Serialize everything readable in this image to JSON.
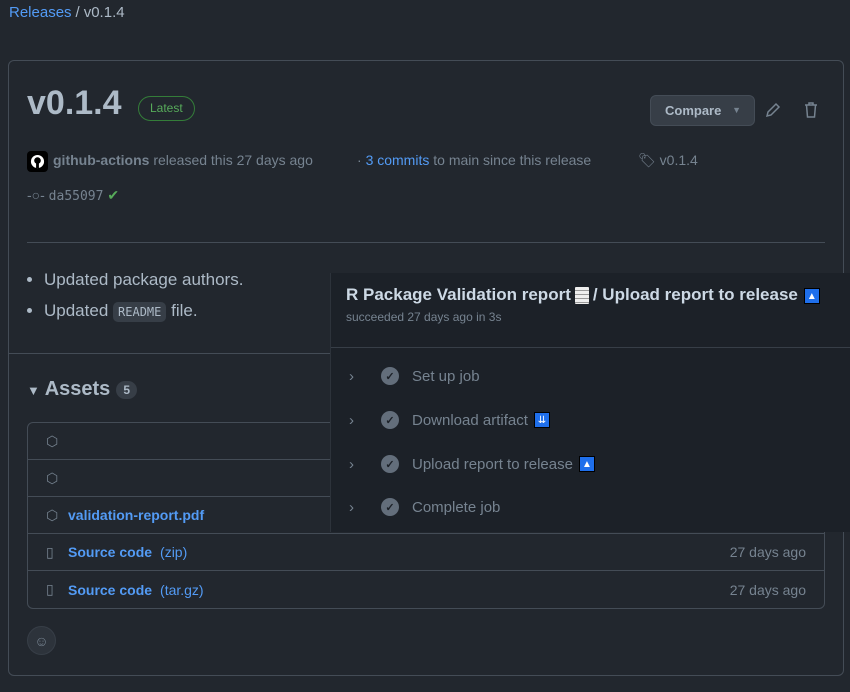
{
  "breadcrumb": {
    "releases": "Releases",
    "separator": "/",
    "current": "v0.1.4"
  },
  "release": {
    "title": "v0.1.4",
    "badge": "Latest",
    "compare": "Compare",
    "author": "github-actions",
    "released": "released this 27 days ago",
    "commits_prefix": "·",
    "commits_link": "3 commits",
    "commits_suffix": "to main since this release",
    "tag": "v0.1.4",
    "commit_sha": "da55097"
  },
  "notes": {
    "item1": "Updated package authors.",
    "item2_pre": "Updated",
    "item2_code": "README",
    "item2_post": "file."
  },
  "assets": {
    "title": "Assets",
    "count": "5",
    "rows": [
      {
        "name": "",
        "date": ""
      },
      {
        "name": "",
        "date": ""
      },
      {
        "name": "validation-report.pdf",
        "date": ""
      },
      {
        "name": "Source code",
        "ext": "(zip)",
        "date": "27 days ago"
      },
      {
        "name": "Source code",
        "ext": "(tar.gz)",
        "date": "27 days ago"
      }
    ]
  },
  "popover": {
    "title_a": "R Package Validation report",
    "title_b": "/ Upload report to release",
    "subtitle": "succeeded 27 days ago in 3s",
    "steps": [
      {
        "label": "Set up job"
      },
      {
        "label": "Download artifact",
        "emoji": "⏬"
      },
      {
        "label": "Upload report to release",
        "emoji": "🔼"
      },
      {
        "label": "Complete job"
      }
    ]
  },
  "colors": {
    "link": "#539bf5",
    "success": "#57ab5a",
    "background": "#22272e",
    "emoji_bg": "#1f6feb"
  }
}
